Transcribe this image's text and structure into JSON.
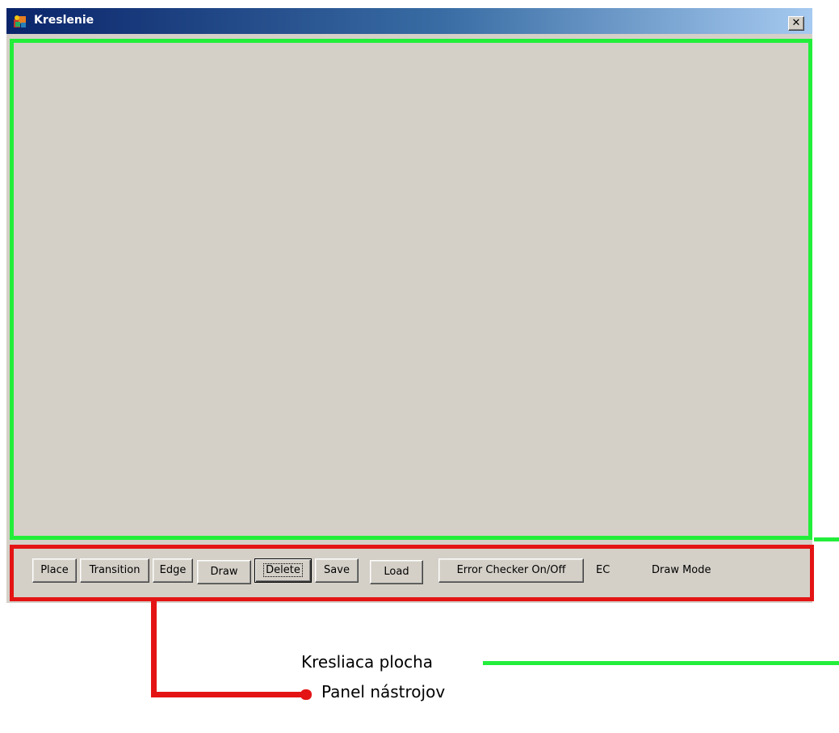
{
  "window": {
    "title": "Kreslenie",
    "close_glyph": "✕"
  },
  "toolbar": {
    "buttons": [
      {
        "label": "Place"
      },
      {
        "label": "Transition"
      },
      {
        "label": "Edge"
      },
      {
        "label": "Draw"
      },
      {
        "label": "Delete"
      },
      {
        "label": "Save"
      },
      {
        "label": "Load"
      },
      {
        "label": "Error Checker On/Off"
      }
    ],
    "ec_label": "EC",
    "mode_label": "Draw Mode"
  },
  "annotations": {
    "drawing_area_label": "Kresliaca plocha",
    "toolbar_label": "Panel nástrojov"
  },
  "colors": {
    "drawing_area_highlight": "#22ee3a",
    "toolbar_highlight": "#e41414",
    "window_face": "#d4d0c8"
  }
}
